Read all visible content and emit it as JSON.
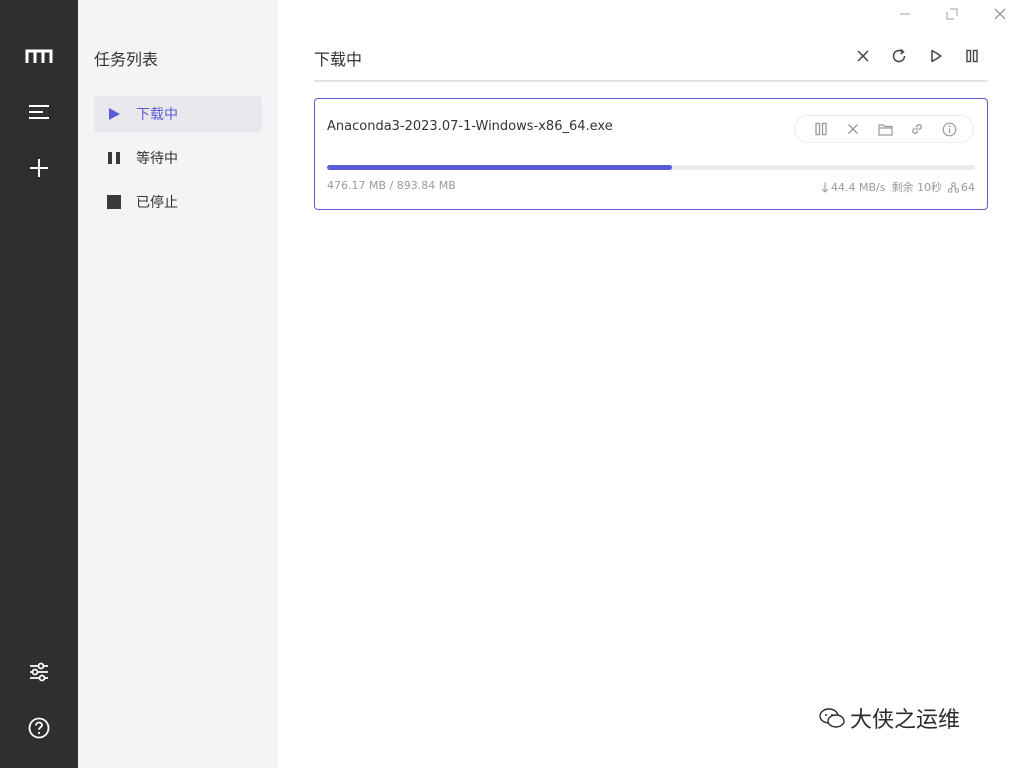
{
  "sidebar": {
    "title": "任务列表",
    "items": [
      {
        "label": "下载中",
        "icon": "play-icon",
        "active": true
      },
      {
        "label": "等待中",
        "icon": "pause-icon",
        "active": false
      },
      {
        "label": "已停止",
        "icon": "stop-icon",
        "active": false
      }
    ]
  },
  "rail": {
    "icons": [
      "logo-icon",
      "menu-icon",
      "add-icon",
      "settings-icon",
      "help-icon"
    ]
  },
  "main": {
    "title": "下载中",
    "toolbar": [
      "close-icon",
      "refresh-icon",
      "play-icon",
      "pause-icon"
    ]
  },
  "task": {
    "name": "Anaconda3-2023.07-1-Windows-x86_64.exe",
    "size_text": "476.17 MB / 893.84 MB",
    "progress": 0.533,
    "speed": "44.4 MB/s",
    "remaining": "剩余 10秒",
    "connections": "64",
    "actions": [
      "pause-icon",
      "close-icon",
      "folder-icon",
      "link-icon",
      "info-icon"
    ]
  },
  "watermark": {
    "text": "大侠之运维"
  },
  "colors": {
    "accent": "#5b5bd6",
    "rail_bg": "#2f2f2f",
    "panel_bg": "#f4f4f6"
  }
}
